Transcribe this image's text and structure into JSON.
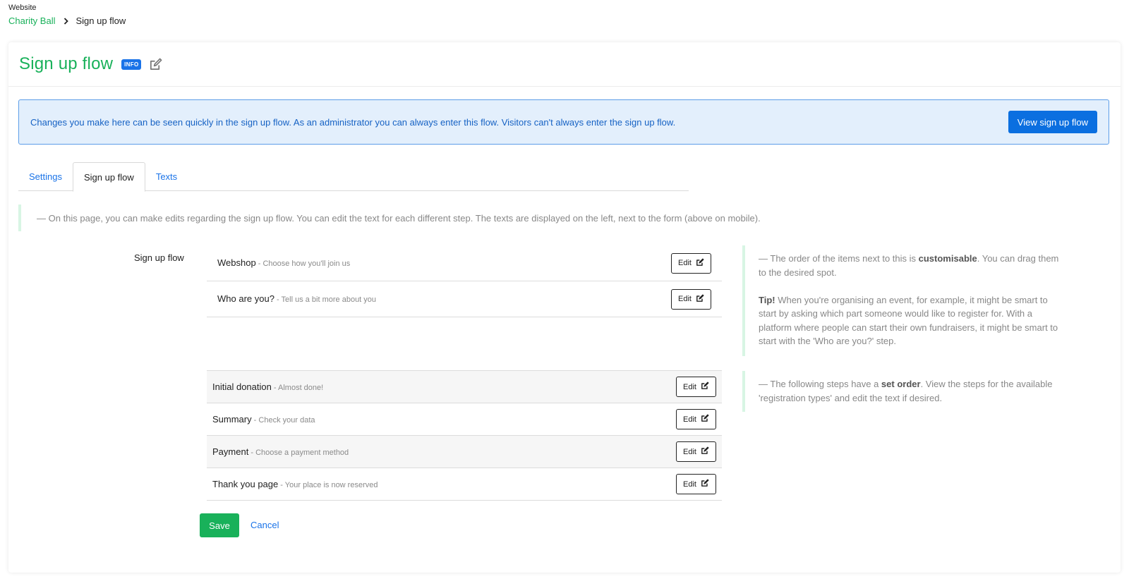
{
  "breadcrumb": {
    "section": "Website",
    "parent": "Charity Ball",
    "current": "Sign up flow"
  },
  "header": {
    "title": "Sign up flow",
    "badge": "INFO"
  },
  "notice": {
    "text": "Changes you make here can be seen quickly in the sign up flow. As an administrator you can always enter this flow. Visitors can't always enter the sign up flow.",
    "button": "View sign up flow"
  },
  "tabs": [
    {
      "label": "Settings",
      "active": false
    },
    {
      "label": "Sign up flow",
      "active": true
    },
    {
      "label": "Texts",
      "active": false
    }
  ],
  "hint": "— On this page, you can make edits regarding the sign up flow. You can edit the text for each different step. The texts are displayed on the left, next to the form (above on mobile).",
  "section_label": "Sign up flow",
  "draggable_steps": [
    {
      "title": "Webshop",
      "sub": " - Choose how you'll join us",
      "edit": "Edit"
    },
    {
      "title": "Who are you?",
      "sub": " - Tell us a bit more about you",
      "edit": "Edit"
    }
  ],
  "fixed_steps": [
    {
      "title": "Initial donation",
      "sub": " - Almost done!",
      "edit": "Edit"
    },
    {
      "title": "Summary",
      "sub": " - Check your data",
      "edit": "Edit"
    },
    {
      "title": "Payment",
      "sub": " - Choose a payment method",
      "edit": "Edit"
    },
    {
      "title": "Thank you page",
      "sub": " - Your place is now reserved",
      "edit": "Edit"
    }
  ],
  "side_note_1": {
    "intro": "— The order of the items next to this is ",
    "bold": "customisable",
    "after": ". You can drag them to the desired spot.",
    "tip_label": "Tip!",
    "tip_text": " When you're organising an event, for example, it might be smart to start by asking which part someone would like to register for. With a platform where people can start their own fundraisers, it might be smart to start with the 'Who are you?' step."
  },
  "side_note_2": {
    "intro": "— The following steps have a ",
    "bold": "set order",
    "after": ". View the steps for the available 'registration types' and edit the text if desired."
  },
  "actions": {
    "save": "Save",
    "cancel": "Cancel"
  },
  "colors": {
    "brand_green": "#19b15a",
    "link_blue": "#1a73e8",
    "notice_bg": "#e3effc"
  }
}
